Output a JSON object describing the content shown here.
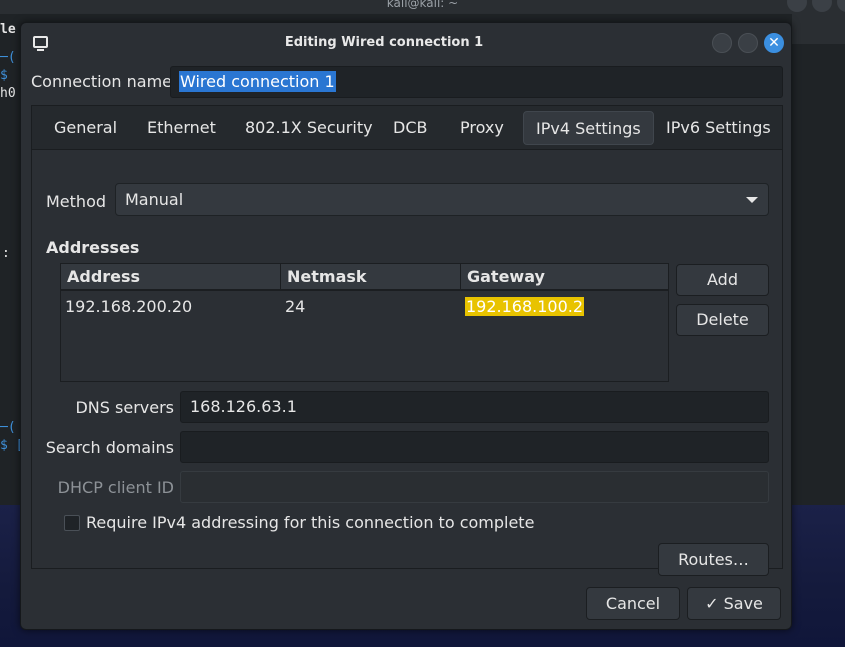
{
  "background": {
    "window_title": "kali@kali: ~",
    "terminal_fragments": [
      "le",
      "─(",
      "$",
      "h0",
      ":",
      "─(",
      "$ ["
    ]
  },
  "dialog": {
    "title": "Editing Wired connection 1",
    "connection_name_label": "Connection name",
    "connection_name_value": "Wired connection 1",
    "tabs": [
      {
        "label": "General"
      },
      {
        "label": "Ethernet"
      },
      {
        "label": "802.1X Security"
      },
      {
        "label": "DCB"
      },
      {
        "label": "Proxy"
      },
      {
        "label": "IPv4 Settings",
        "active": true
      },
      {
        "label": "IPv6 Settings"
      }
    ],
    "method_label": "Method",
    "method_value": "Manual",
    "addresses_label": "Addresses",
    "table": {
      "columns": [
        "Address",
        "Netmask",
        "Gateway"
      ],
      "rows": [
        [
          "192.168.200.20",
          "24",
          "192.168.100.2"
        ]
      ]
    },
    "add_label": "Add",
    "delete_label": "Delete",
    "dns_label": "DNS servers",
    "dns_value": "168.126.63.1",
    "search_label": "Search domains",
    "search_value": "",
    "dhcp_label": "DHCP client ID",
    "dhcp_value": "",
    "require_label": "Require IPv4 addressing for this connection to complete",
    "require_checked": false,
    "routes_label": "Routes…",
    "cancel_label": "Cancel",
    "save_label": "Save",
    "save_icon": "check-icon"
  },
  "colors": {
    "accent": "#2a76d2",
    "close_button": "#3b8fe0",
    "gateway_highlight": "#e8c300"
  }
}
